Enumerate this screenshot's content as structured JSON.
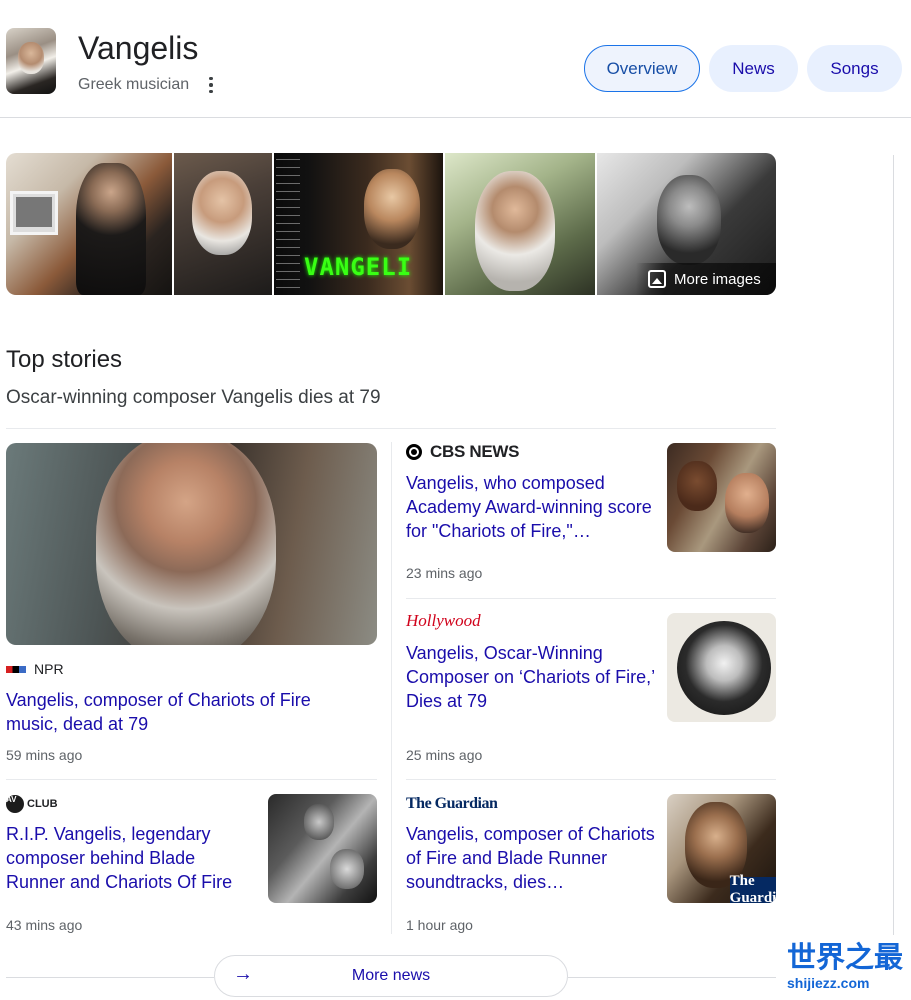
{
  "header": {
    "title": "Vangelis",
    "subtitle": "Greek musician",
    "tabs": [
      {
        "label": "Overview",
        "active": true
      },
      {
        "label": "News",
        "active": false
      },
      {
        "label": "Songs",
        "active": false
      }
    ]
  },
  "images": {
    "more_label": "More images",
    "overlay_text": "VANGELI"
  },
  "top_stories": {
    "title": "Top stories",
    "headline": "Oscar-winning composer Vangelis dies at 79",
    "stories": [
      {
        "source": "NPR",
        "title": "Vangelis, composer of Chariots of Fire music, dead at 79",
        "time": "59 mins ago"
      },
      {
        "source": "CBS NEWS",
        "title": "Vangelis, who composed Academy Award-winning score for \"Chariots of Fire,\"…",
        "time": "23 mins ago"
      },
      {
        "source": "Hollywood",
        "title": "Vangelis, Oscar-Winning Composer on ‘Chariots of Fire,’ Dies at 79",
        "time": "25 mins ago"
      },
      {
        "source": "CLUB",
        "title": "R.I.P. Vangelis, legendary composer behind Blade Runner and Chariots Of Fire",
        "time": "43 mins ago"
      },
      {
        "source": "The Guardian",
        "title": "Vangelis, composer of Chariots of Fire and Blade Runner soundtracks, dies…",
        "time": "1 hour ago"
      }
    ],
    "av_badge": "AV",
    "guardian_badge": "The Guardi"
  },
  "more_news": {
    "label": "More news",
    "arrow": "→"
  },
  "watermark": {
    "line1": "世界之最",
    "line2": "shijiezz.com"
  },
  "colors": {
    "link": "#1a0dab",
    "chip_bg": "#e8f0fe",
    "chip_active_border": "#1a73e8"
  }
}
